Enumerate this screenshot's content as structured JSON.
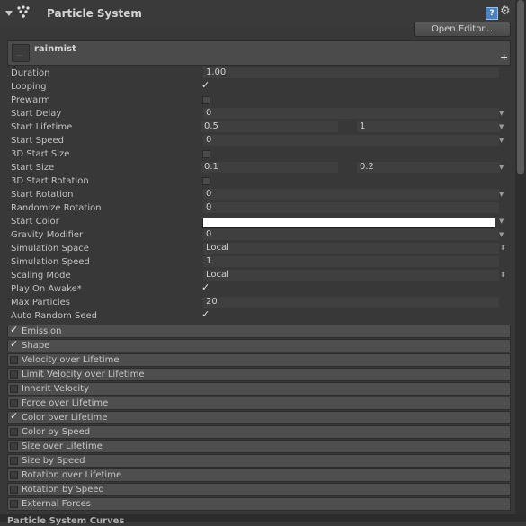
{
  "header": {
    "title": "Particle System",
    "open_editor_label": "Open Editor...",
    "icons": [
      "fold-arrow-icon",
      "particle-system-icon",
      "help-icon",
      "gear-icon"
    ]
  },
  "module": {
    "name": "rainmist",
    "add_label": "+"
  },
  "properties": {
    "duration": {
      "label": "Duration",
      "value": "1.00"
    },
    "looping": {
      "label": "Looping",
      "checked": true
    },
    "prewarm": {
      "label": "Prewarm",
      "checked": false
    },
    "start_delay": {
      "label": "Start Delay",
      "value": "0"
    },
    "start_lifetime": {
      "label": "Start Lifetime",
      "min": "0.5",
      "max": "1"
    },
    "start_speed": {
      "label": "Start Speed",
      "value": "0"
    },
    "start_size_3d": {
      "label": "3D Start Size",
      "checked": false
    },
    "start_size": {
      "label": "Start Size",
      "min": "0.1",
      "max": "0.2"
    },
    "start_rotation_3d": {
      "label": "3D Start Rotation",
      "checked": false
    },
    "start_rotation": {
      "label": "Start Rotation",
      "value": "0"
    },
    "randomize_rotation": {
      "label": "Randomize Rotation",
      "value": "0"
    },
    "start_color": {
      "label": "Start Color",
      "color": "#ffffff"
    },
    "gravity_modifier": {
      "label": "Gravity Modifier",
      "value": "0"
    },
    "simulation_space": {
      "label": "Simulation Space",
      "value": "Local"
    },
    "simulation_speed": {
      "label": "Simulation Speed",
      "value": "1"
    },
    "scaling_mode": {
      "label": "Scaling Mode",
      "value": "Local"
    },
    "play_on_awake": {
      "label": "Play On Awake*",
      "checked": true
    },
    "max_particles": {
      "label": "Max Particles",
      "value": "20"
    },
    "auto_random_seed": {
      "label": "Auto Random Seed",
      "checked": true
    }
  },
  "modules": [
    {
      "label": "Emission",
      "enabled": true
    },
    {
      "label": "Shape",
      "enabled": true
    },
    {
      "label": "Velocity over Lifetime",
      "enabled": false
    },
    {
      "label": "Limit Velocity over Lifetime",
      "enabled": false
    },
    {
      "label": "Inherit Velocity",
      "enabled": false
    },
    {
      "label": "Force over Lifetime",
      "enabled": false
    },
    {
      "label": "Color over Lifetime",
      "enabled": true
    },
    {
      "label": "Color by Speed",
      "enabled": false
    },
    {
      "label": "Size over Lifetime",
      "enabled": false
    },
    {
      "label": "Size by Speed",
      "enabled": false
    },
    {
      "label": "Rotation over Lifetime",
      "enabled": false
    },
    {
      "label": "Rotation by Speed",
      "enabled": false
    },
    {
      "label": "External Forces",
      "enabled": false
    }
  ],
  "footer": {
    "text": "Particle System Curves"
  }
}
